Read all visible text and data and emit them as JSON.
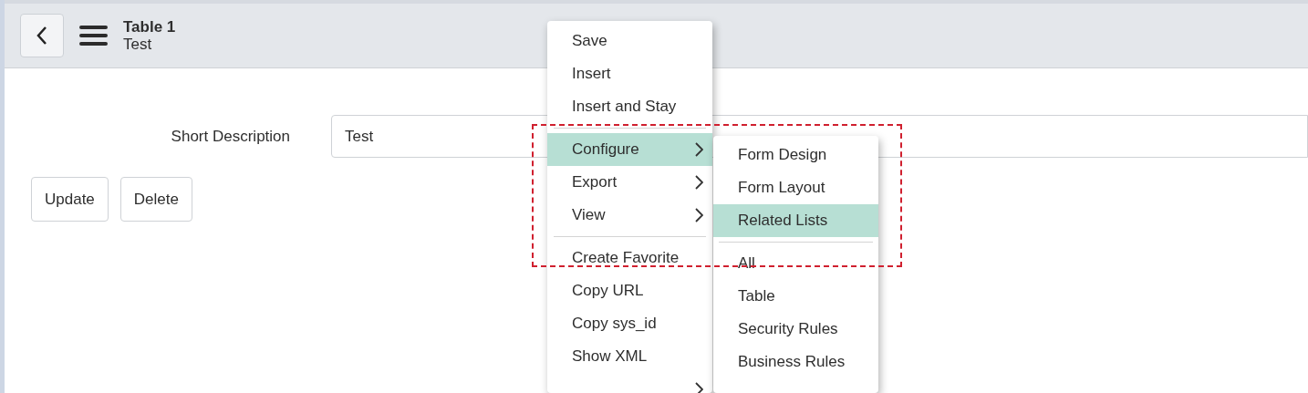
{
  "header": {
    "title": "Table 1",
    "subtitle": "Test"
  },
  "form": {
    "label": "Short Description",
    "value": "Test"
  },
  "buttons": [
    "Update",
    "Delete"
  ],
  "context_menu": [
    {
      "kind": "item",
      "label": "Save",
      "submenu": false,
      "selected": false
    },
    {
      "kind": "item",
      "label": "Insert",
      "submenu": false,
      "selected": false
    },
    {
      "kind": "item",
      "label": "Insert and Stay",
      "submenu": false,
      "selected": false
    },
    {
      "kind": "separator"
    },
    {
      "kind": "item",
      "label": "Configure",
      "submenu": true,
      "selected": true
    },
    {
      "kind": "item",
      "label": "Export",
      "submenu": true,
      "selected": false
    },
    {
      "kind": "item",
      "label": "View",
      "submenu": true,
      "selected": false
    },
    {
      "kind": "separator"
    },
    {
      "kind": "item",
      "label": "Create Favorite",
      "submenu": false,
      "selected": false
    },
    {
      "kind": "item",
      "label": "Copy URL",
      "submenu": false,
      "selected": false
    },
    {
      "kind": "item",
      "label": "Copy sys_id",
      "submenu": false,
      "selected": false
    },
    {
      "kind": "item",
      "label": "Show XML",
      "submenu": false,
      "selected": false
    },
    {
      "kind": "item",
      "submenu": true,
      "selected": false
    }
  ],
  "submenu": [
    {
      "kind": "item",
      "label": "Form Design",
      "selected": false
    },
    {
      "kind": "item",
      "label": "Form Layout",
      "selected": false
    },
    {
      "kind": "item",
      "label": "Related Lists",
      "selected": true
    },
    {
      "kind": "separator"
    },
    {
      "kind": "item",
      "label": "All",
      "selected": false
    },
    {
      "kind": "item",
      "label": "Table",
      "selected": false
    },
    {
      "kind": "item",
      "label": "Security Rules",
      "selected": false
    },
    {
      "kind": "item",
      "label": "Business Rules",
      "selected": false
    }
  ],
  "highlight_frame": {
    "visible": true
  }
}
